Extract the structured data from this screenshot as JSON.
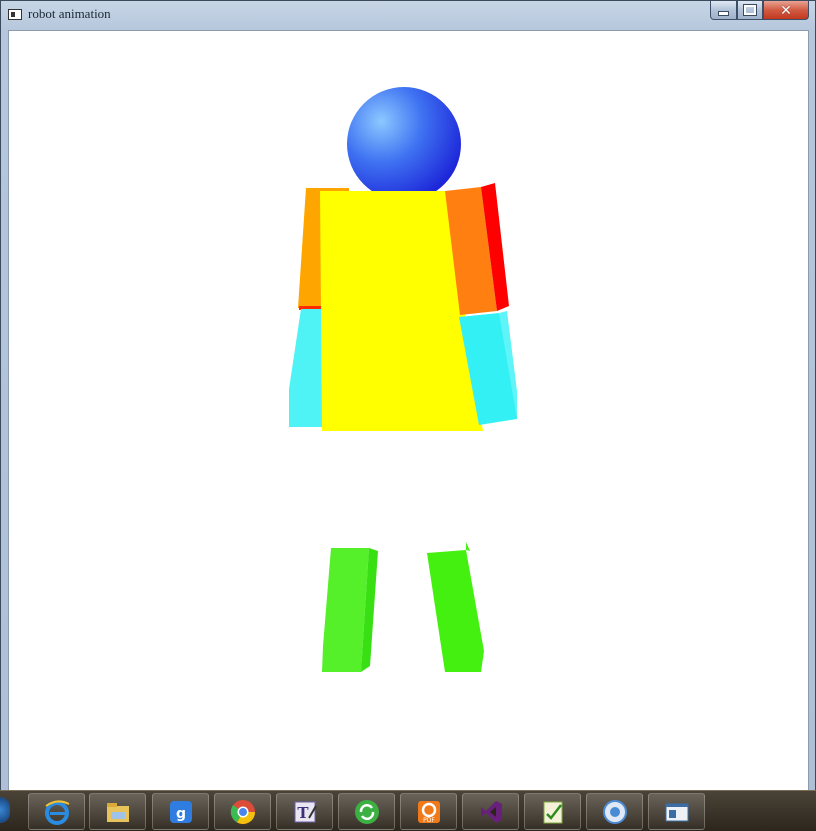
{
  "window": {
    "title": "robot animation",
    "controls": {
      "minimize_icon": "minimize-icon",
      "maximize_icon": "maximize-icon",
      "close_icon": "close-icon"
    }
  },
  "scene": {
    "background": "#ffffff",
    "parts": [
      {
        "name": "head",
        "shape": "sphere",
        "color": "#2e5cf5"
      },
      {
        "name": "torso",
        "shape": "box",
        "color": "#ffff00"
      },
      {
        "name": "left-upper-arm",
        "shape": "box",
        "color": "#ffa500"
      },
      {
        "name": "right-upper-arm",
        "shape": "box",
        "color": "#ff7f00"
      },
      {
        "name": "left-lower-arm",
        "shape": "box",
        "color": "#4ff2f5"
      },
      {
        "name": "right-lower-arm",
        "shape": "box",
        "color": "#33f0f5"
      },
      {
        "name": "left-leg",
        "shape": "box",
        "color": "#55f02a"
      },
      {
        "name": "right-leg",
        "shape": "box",
        "color": "#44f010"
      }
    ]
  },
  "taskbar": {
    "items": [
      {
        "icon": "internet-explorer-icon",
        "color": "#2a8be0"
      },
      {
        "icon": "file-explorer-icon",
        "color": "#e8c25a"
      },
      {
        "icon": "baidu-icon",
        "color": "#2f7de1"
      },
      {
        "icon": "chrome-icon",
        "color": "#dd4b39"
      },
      {
        "icon": "text-editor-icon",
        "color": "#6c5fa8"
      },
      {
        "icon": "refresh-app-icon",
        "color": "#3cb043"
      },
      {
        "icon": "pdf-icon",
        "color": "#f07a1a"
      },
      {
        "icon": "visual-studio-icon",
        "color": "#68217a"
      },
      {
        "icon": "notes-app-icon",
        "color": "#7fae3c"
      },
      {
        "icon": "media-player-icon",
        "color": "#4a8bd4"
      },
      {
        "icon": "window-app-icon",
        "color": "#3b6ea5"
      }
    ]
  }
}
